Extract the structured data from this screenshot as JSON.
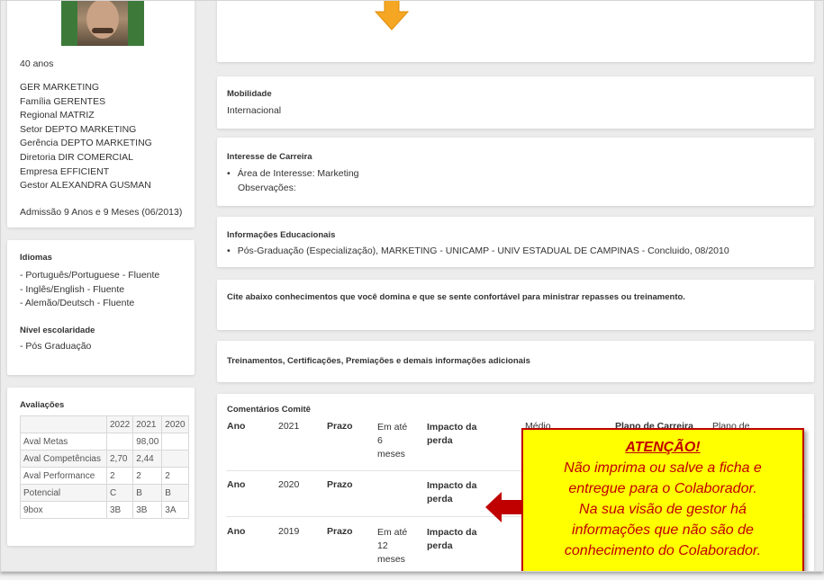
{
  "profile": {
    "age": "40 anos",
    "info_lines": [
      "GER MARKETING",
      "Família GERENTES",
      "Regional MATRIZ",
      "Setor DEPTO MARKETING",
      "Gerência DEPTO MARKETING",
      "Diretoria DIR COMERCIAL",
      "Empresa EFFICIENT",
      "Gestor ALEXANDRA GUSMAN"
    ],
    "admission": "Admissão 9 Anos e 9 Meses (06/2013)"
  },
  "languages": {
    "title": "Idiomas",
    "items": [
      "- Português/Portuguese - Fluente",
      "- Inglês/English - Fluente",
      "- Alemão/Deutsch - Fluente"
    ],
    "education_title": "Nível escolaridade",
    "education_level": "- Pós Graduação"
  },
  "evaluations": {
    "title": "Avaliações",
    "headers": [
      "",
      "2022",
      "2021",
      "2020"
    ],
    "rows": [
      [
        "Aval Metas",
        "",
        "98,00",
        ""
      ],
      [
        "Aval Competências",
        "2,70",
        "2,44",
        ""
      ],
      [
        "Aval Performance",
        "2",
        "2",
        "2"
      ],
      [
        "Potencial",
        "C",
        "B",
        "B"
      ],
      [
        "9box",
        "3B",
        "3B",
        "3A"
      ]
    ]
  },
  "mobility": {
    "title": "Mobilidade",
    "value": "Internacional"
  },
  "career": {
    "title": "Interesse de Carreira",
    "area": "Área de Interesse: Marketing",
    "notes": "Observações:"
  },
  "education": {
    "title": "Informações Educacionais",
    "item": "Pós-Graduação (Especialização), MARKETING - UNICAMP - UNIV ESTADUAL DE CAMPINAS - Concluido, 08/2010"
  },
  "knowledge": {
    "title": "Cite abaixo conhecimentos que você domina e que se sente confortável para ministrar repasses ou treinamento."
  },
  "trainings": {
    "title": "Treinamentos, Certificações, Premiações e demais informações adicionais"
  },
  "committee": {
    "title": "Comentários Comitê",
    "label_year": "Ano",
    "label_deadline": "Prazo",
    "label_impact": "Impacto da perda",
    "rows": [
      {
        "year": "2021",
        "deadline": "Em até 6 meses",
        "impact_value": "Médio",
        "plan_label": "Plano de Carreira",
        "plan_value": "Plano de"
      },
      {
        "year": "2020",
        "deadline": "",
        "impact_value": "",
        "plan_label": "",
        "plan_value": ""
      },
      {
        "year": "2019",
        "deadline": "Em até 12 meses",
        "impact_value": "",
        "plan_label": "",
        "plan_value": ""
      }
    ]
  },
  "callout": {
    "title": "ATENÇÃO!",
    "lines": [
      "Não imprima ou salve a ficha e",
      "entregue para o Colaborador.",
      "Na sua visão de gestor há",
      "informações que não são de",
      "conhecimento do Colaborador."
    ]
  },
  "colors": {
    "accent_arrow": "#f5a623",
    "callout_bg": "#ffff00",
    "callout_text": "#c00000",
    "red_arrow": "#c00000"
  }
}
